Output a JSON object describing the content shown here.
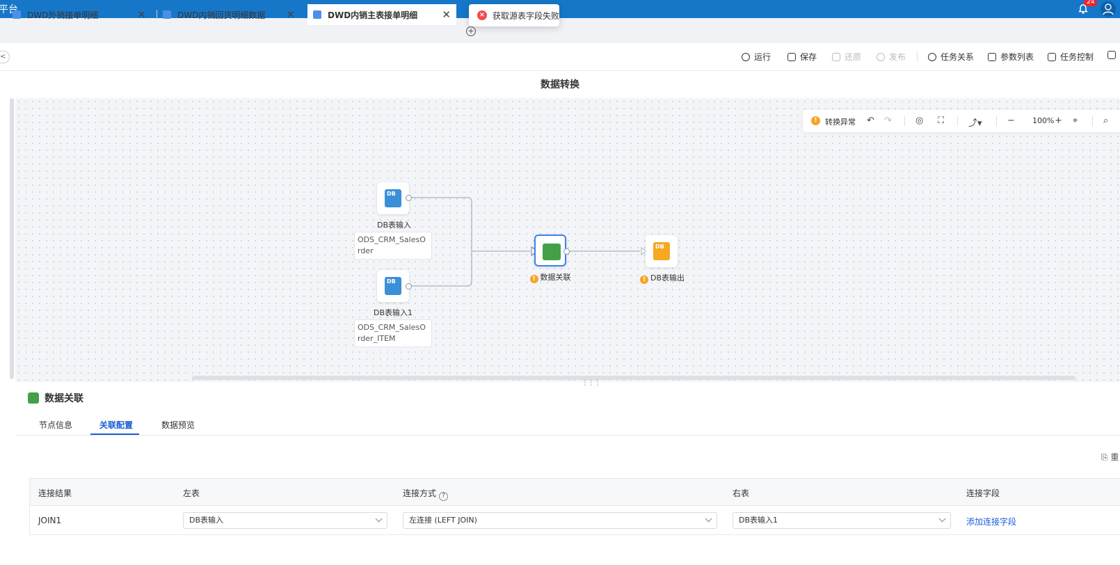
{
  "app": {
    "brand": "平台",
    "notification_count": "24"
  },
  "toast": {
    "message": "获取源表字段失败"
  },
  "tabs": [
    {
      "label": "DWD外销接单明细",
      "active": false
    },
    {
      "label": "DWD内销回货明细数据",
      "active": false
    },
    {
      "label": "DWD内销主表接单明细",
      "active": true
    }
  ],
  "toolbar": {
    "collapse_glyph": "<",
    "run": "运行",
    "save": "保存",
    "restore": "还原",
    "publish": "发布",
    "task_relation": "任务关系",
    "param_list": "参数列表",
    "task_control": "任务控制"
  },
  "canvas": {
    "title": "数据转换",
    "status": "转换异常",
    "zoom": "100%"
  },
  "nodes": {
    "input1": {
      "label": "DB表输入",
      "table": "ODS_CRM_SalesOrder",
      "icon": "DB"
    },
    "input2": {
      "label": "DB表输入1",
      "table": "ODS_CRM_SalesOrder_ITEM",
      "icon": "DB"
    },
    "join": {
      "label": "数据关联"
    },
    "output": {
      "label": "DB表输出",
      "icon": "DB"
    }
  },
  "panel": {
    "title": "数据关联",
    "tabs": [
      "节点信息",
      "关联配置",
      "数据预览"
    ],
    "active_tab": "关联配置",
    "corner": "重",
    "table": {
      "headers": [
        "连接结果",
        "左表",
        "连接方式",
        "右表",
        "连接字段"
      ],
      "row": {
        "result": "JOIN1",
        "left": "DB表输入",
        "join_type": "左连接 (LEFT JOIN)",
        "right": "DB表输入1",
        "add_field": "添加连接字段"
      }
    }
  },
  "colors": {
    "primary": "#1677c8",
    "accent": "#1a5fd6",
    "error": "#f5484d",
    "warning": "#f5a623",
    "join_green": "#43a047"
  }
}
